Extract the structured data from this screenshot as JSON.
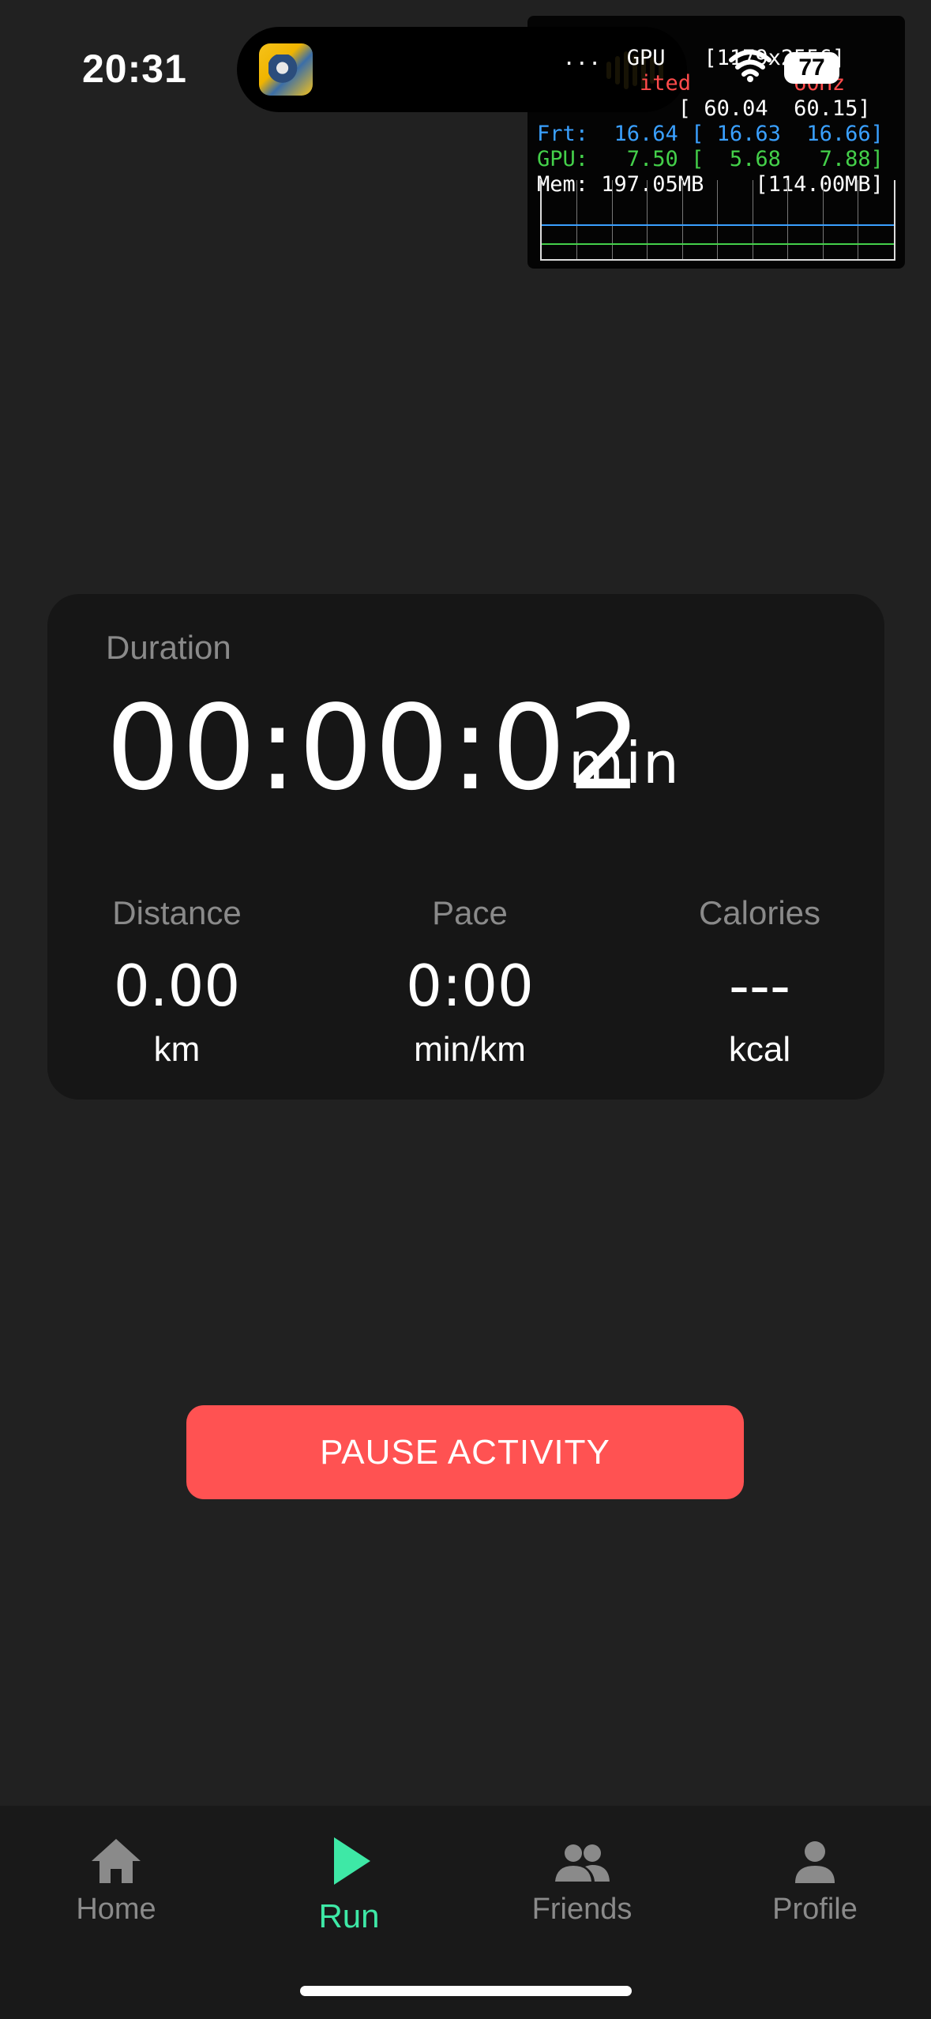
{
  "status_bar": {
    "time": "20:31",
    "battery": "77"
  },
  "perf_overlay": {
    "lines": [
      {
        "text": "  ...  GPU   [1179x2556]",
        "color": "white"
      },
      {
        "text": "        ited        60Hz",
        "color": "red"
      },
      {
        "text": "           [ 60.04  60.15]",
        "color": "white"
      },
      {
        "text": "Frt:  16.64 [ 16.63  16.66]",
        "color": "blue"
      },
      {
        "text": "GPU:   7.50 [  5.68   7.88]",
        "color": "green"
      },
      {
        "text": "Mem: 197.05MB    [114.00MB]",
        "color": "white"
      }
    ]
  },
  "activity": {
    "duration_label": "Duration",
    "duration_value": "00:00:02",
    "duration_unit": "min",
    "distance": {
      "label": "Distance",
      "value": "0.00",
      "unit": "km"
    },
    "pace": {
      "label": "Pace",
      "value": "0:00",
      "unit": "min/km"
    },
    "calories": {
      "label": "Calories",
      "value": "---",
      "unit": "kcal"
    }
  },
  "pause_button": {
    "label": "PAUSE ACTIVITY"
  },
  "tabs": [
    {
      "label": "Home",
      "icon": "home-icon",
      "active": false
    },
    {
      "label": "Run",
      "icon": "play-icon",
      "active": true
    },
    {
      "label": "Friends",
      "icon": "people-icon",
      "active": false
    },
    {
      "label": "Profile",
      "icon": "person-icon",
      "active": false
    }
  ],
  "colors": {
    "background": "#212121",
    "card": "#161616",
    "accent": "#3ee8a6",
    "pause": "#ff5252"
  }
}
